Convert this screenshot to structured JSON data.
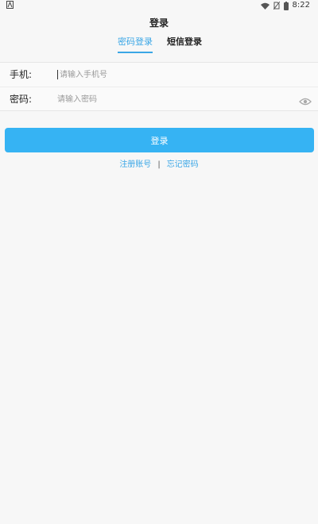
{
  "status_bar": {
    "time": "8:22",
    "left_icon": "android-notification-icon",
    "wifi_icon": "wifi-icon",
    "sim_icon": "no-sim-icon",
    "battery_icon": "battery-icon"
  },
  "header": {
    "title": "登录"
  },
  "tabs": [
    {
      "label": "密码登录",
      "active": true
    },
    {
      "label": "短信登录",
      "active": false
    }
  ],
  "form": {
    "phone": {
      "label": "手机:",
      "placeholder": "请输入手机号",
      "value": ""
    },
    "password": {
      "label": "密码:",
      "placeholder": "请输入密码",
      "value": "",
      "toggle_icon": "eye-icon"
    }
  },
  "actions": {
    "login_label": "登录",
    "register_label": "注册账号",
    "separator": "|",
    "forgot_label": "忘记密码"
  },
  "colors": {
    "accent": "#36b3f3",
    "link": "#3aa6e6",
    "background": "#f7f7f7"
  }
}
